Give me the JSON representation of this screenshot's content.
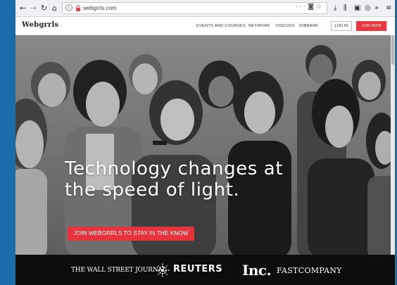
{
  "browser": {
    "url": "webgrrls.com",
    "icons": [
      "back-icon",
      "forward-icon",
      "reload-icon",
      "home-icon",
      "info-icon",
      "lock-icon",
      "more-icon",
      "pocket-icon",
      "bookmark-star-icon",
      "downloads-icon",
      "library-icon",
      "sidebar-icon",
      "sync-icon",
      "overflow-icon",
      "menu-icon"
    ]
  },
  "site": {
    "logo": "Webgrrls",
    "nav": [
      "EVENTS AND COURSES",
      "NETWORK",
      "DISCUSS",
      "JOBBANK"
    ],
    "login": "LOG IN",
    "join": "JOIN NOW"
  },
  "hero": {
    "headline_line1": "Technology changes at",
    "headline_line2": "the speed of light.",
    "cta": "JOIN WEBGRRLS TO STAY IN THE KNOW"
  },
  "press": {
    "wsj": "THE WALL STREET JOURNAL",
    "reuters": "REUTERS",
    "inc": "Inc.",
    "fast_company": "FASTCOMPANY"
  },
  "colors": {
    "accent_red": "#e5343b",
    "press_bg": "#0d0d0d",
    "desktop_blue": "#1c6ca9"
  }
}
